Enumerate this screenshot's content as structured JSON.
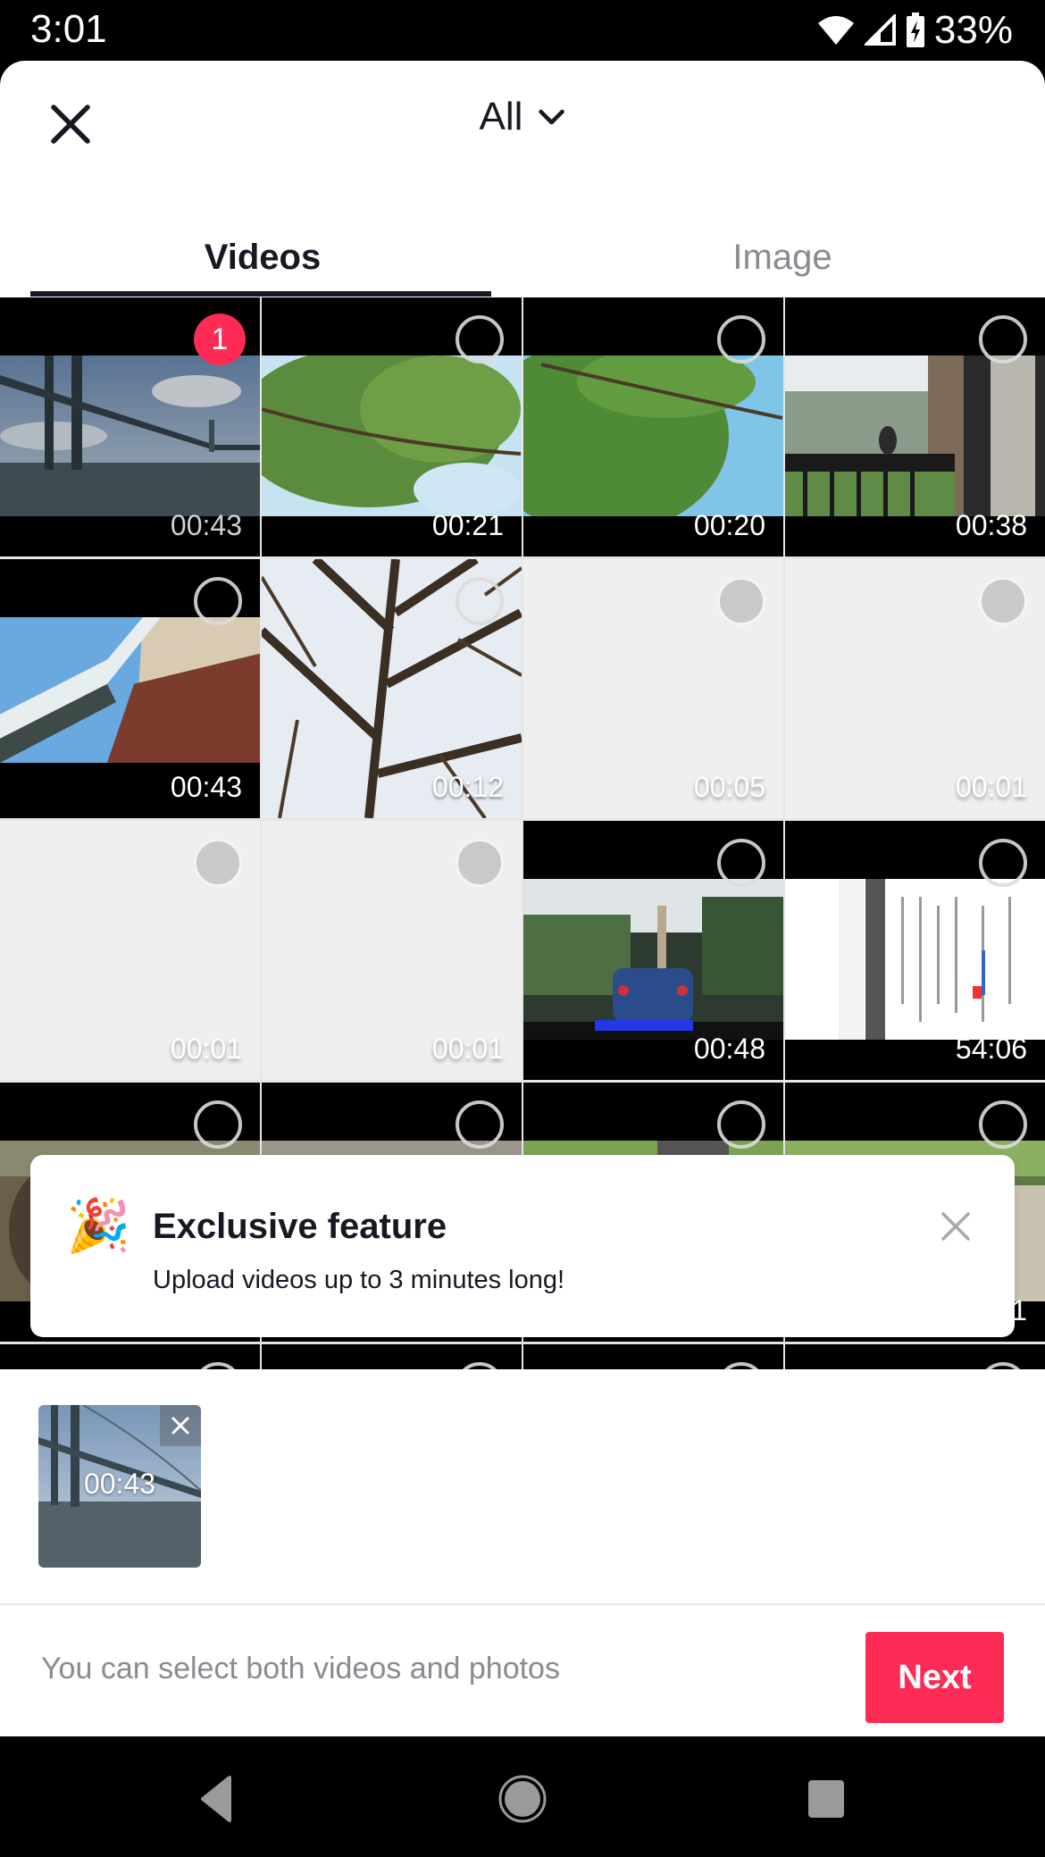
{
  "status_bar": {
    "time": "3:01",
    "battery_percent": "33%",
    "icons": [
      "wifi-icon",
      "cell-signal-icon",
      "battery-charging-icon"
    ]
  },
  "header": {
    "close_icon": "close-icon",
    "album_label": "All",
    "album_chevron": "chevron-down-icon"
  },
  "tabs": [
    {
      "label": "Videos",
      "active": true
    },
    {
      "label": "Image",
      "active": false
    }
  ],
  "grid": {
    "items": [
      {
        "duration": "00:43",
        "selected": true,
        "selection_index": "1",
        "thumb": "bridge",
        "loaded": true
      },
      {
        "duration": "00:21",
        "selected": false,
        "thumb": "tree-green",
        "loaded": true
      },
      {
        "duration": "00:20",
        "selected": false,
        "thumb": "tree-green-sky",
        "loaded": true
      },
      {
        "duration": "00:38",
        "selected": false,
        "thumb": "balcony-bird",
        "loaded": true
      },
      {
        "duration": "00:43",
        "selected": false,
        "thumb": "roof-brick",
        "loaded": true
      },
      {
        "duration": "00:12",
        "selected": false,
        "thumb": "bare-tree",
        "loaded": true
      },
      {
        "duration": "00:05",
        "selected": false,
        "thumb": "",
        "loaded": false
      },
      {
        "duration": "00:01",
        "selected": false,
        "thumb": "",
        "loaded": false
      },
      {
        "duration": "00:01",
        "selected": false,
        "thumb": "",
        "loaded": false
      },
      {
        "duration": "00:01",
        "selected": false,
        "thumb": "",
        "loaded": false
      },
      {
        "duration": "00:48",
        "selected": false,
        "thumb": "car-rain",
        "loaded": true
      },
      {
        "duration": "54:06",
        "selected": false,
        "thumb": "screen-recording",
        "loaded": true
      },
      {
        "duration": "",
        "selected": false,
        "thumb": "outdoor-1",
        "loaded": true
      },
      {
        "duration": "",
        "selected": false,
        "thumb": "outdoor-2",
        "loaded": true
      },
      {
        "duration": "",
        "selected": false,
        "thumb": "outdoor-3",
        "loaded": true
      },
      {
        "duration": "1",
        "selected": false,
        "thumb": "outdoor-4",
        "loaded": true
      },
      {
        "duration": "",
        "selected": false,
        "thumb": "",
        "loaded": true
      },
      {
        "duration": "",
        "selected": false,
        "thumb": "",
        "loaded": true
      },
      {
        "duration": "",
        "selected": false,
        "thumb": "",
        "loaded": true
      },
      {
        "duration": "",
        "selected": false,
        "thumb": "",
        "loaded": true
      }
    ]
  },
  "banner": {
    "emoji": "🎉",
    "title": "Exclusive feature",
    "text": "Upload videos up to 3 minutes long!",
    "close_icon": "close-icon"
  },
  "tray": {
    "items": [
      {
        "duration": "00:43",
        "thumb": "bridge"
      }
    ]
  },
  "footer": {
    "hint": "You can select both videos and photos",
    "next_label": "Next"
  },
  "colors": {
    "accent": "#fe2c55",
    "text_primary": "#161823",
    "text_secondary": "#8a8b91"
  },
  "nav_bar": {
    "buttons": [
      "back-icon",
      "home-icon",
      "recents-icon"
    ]
  }
}
